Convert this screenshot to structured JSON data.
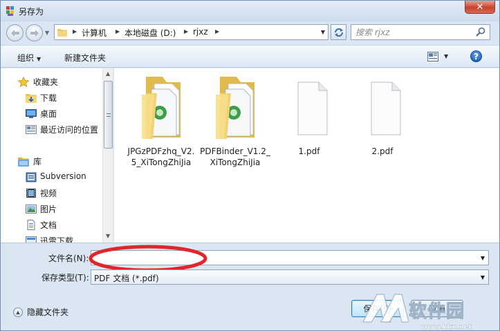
{
  "window": {
    "title": "另存为",
    "close_glyph": "✕",
    "accent_color": "#c7432f"
  },
  "address": {
    "crumbs": [
      "计算机",
      "本地磁盘 (D:)",
      "rjxz"
    ]
  },
  "search": {
    "placeholder": "搜索 rjxz"
  },
  "toolbar": {
    "organize_label": "组织",
    "new_folder_label": "新建文件夹",
    "help_glyph": "?"
  },
  "nav": {
    "favorites_label": "收藏夹",
    "favorites": [
      "下载",
      "桌面",
      "最近访问的位置"
    ],
    "library_label": "库",
    "library": [
      "Subversion",
      "视频",
      "图片",
      "文档",
      "迅雷下载"
    ]
  },
  "files": [
    {
      "name": "JPGzPDFzhq_V2.5_XiTongZhiJia",
      "icon": "folder-with-documents-icon"
    },
    {
      "name": "PDFBinder_V1.2_XiTongZhiJia",
      "icon": "folder-with-documents-icon"
    },
    {
      "name": "1.pdf",
      "icon": "blank-document-icon"
    },
    {
      "name": "2.pdf",
      "icon": "blank-document-icon"
    }
  ],
  "form": {
    "filename_label": "文件名(N):",
    "filename_value": "",
    "filetype_label": "保存类型(T):",
    "filetype_value": "PDF 文档 (*.pdf)",
    "annotation_color": "#e0262a"
  },
  "footer": {
    "hide_folders_label": "隐藏文件夹",
    "save_label": "保存(S)",
    "cancel_label": "取消"
  },
  "watermark": {
    "text": "软件园",
    "url": "www.kkx.net"
  }
}
